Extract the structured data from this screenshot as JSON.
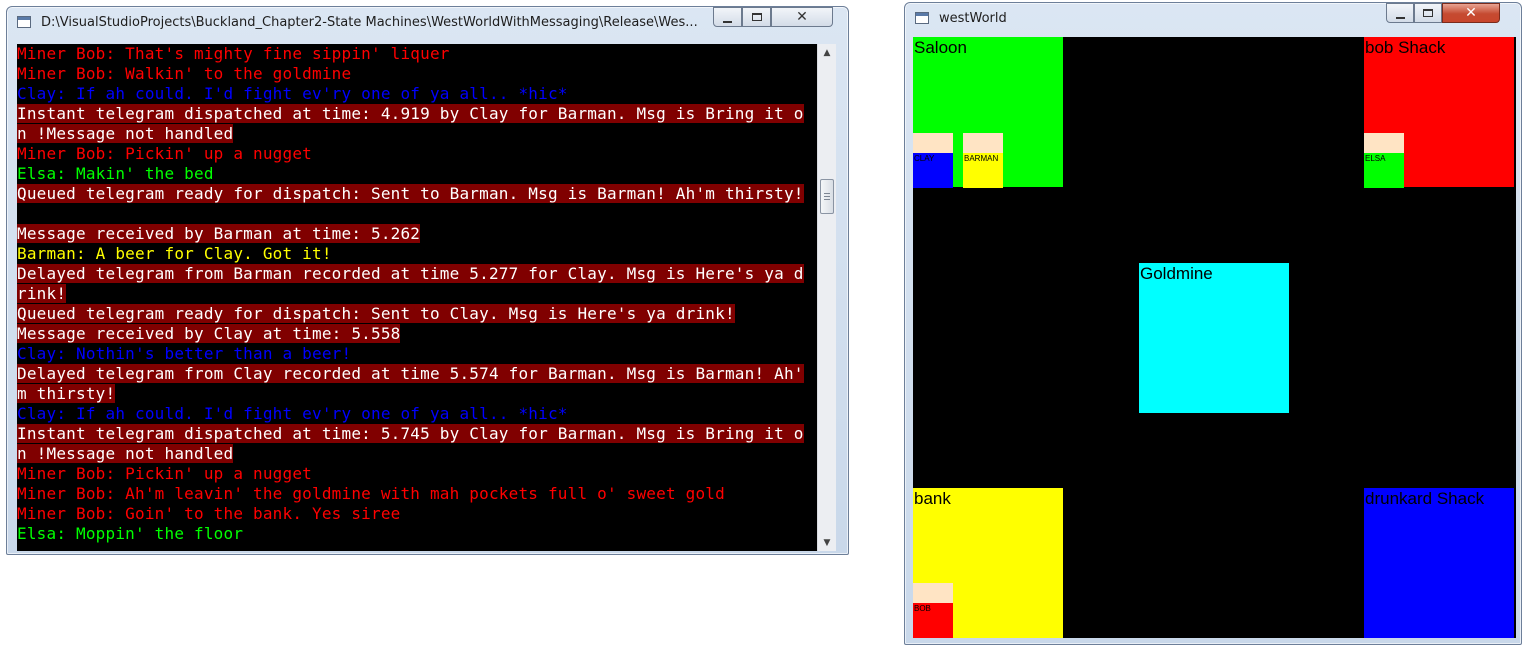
{
  "console_window": {
    "title": "D:\\VisualStudioProjects\\Buckland_Chapter2-State Machines\\WestWorldWithMessaging\\Release\\Wes...",
    "min_label": "",
    "max_label": "",
    "close_label": "✕",
    "scroll_up": "▲",
    "scroll_down": "▼",
    "lines": [
      {
        "text": "Miner Bob: That's mighty fine sippin' liquer",
        "color": "#ff0000",
        "highlight": false
      },
      {
        "text": "Miner Bob: Walkin' to the goldmine",
        "color": "#ff0000",
        "highlight": false
      },
      {
        "text": "Clay: If ah could. I'd fight ev'ry one of ya all.. *hic*",
        "color": "#0000ff",
        "highlight": false
      },
      {
        "text": "Instant telegram dispatched at time: 4.919 by Clay for Barman. Msg is Bring it o",
        "color": "#ffffff",
        "highlight": true
      },
      {
        "text": "n !Message not handled",
        "color": "#ffffff",
        "highlight": true
      },
      {
        "text": "Miner Bob: Pickin' up a nugget",
        "color": "#ff0000",
        "highlight": false
      },
      {
        "text": "Elsa: Makin' the bed",
        "color": "#00ff00",
        "highlight": false
      },
      {
        "text": "Queued telegram ready for dispatch: Sent to Barman. Msg is Barman! Ah'm thirsty!",
        "color": "#ffffff",
        "highlight": true
      },
      {
        "text": "",
        "color": "#ffffff",
        "highlight": false
      },
      {
        "text": "Message received by Barman at time: 5.262",
        "color": "#ffffff",
        "highlight": true
      },
      {
        "text": "Barman: A beer for Clay. Got it!",
        "color": "#ffff00",
        "highlight": false
      },
      {
        "text": "Delayed telegram from Barman recorded at time 5.277 for Clay. Msg is Here's ya d",
        "color": "#ffffff",
        "highlight": true
      },
      {
        "text": "rink!",
        "color": "#ffffff",
        "highlight": true
      },
      {
        "text": "Queued telegram ready for dispatch: Sent to Clay. Msg is Here's ya drink!",
        "color": "#ffffff",
        "highlight": true
      },
      {
        "text": "Message received by Clay at time: 5.558",
        "color": "#ffffff",
        "highlight": true
      },
      {
        "text": "Clay: Nothin's better than a beer!",
        "color": "#0000ff",
        "highlight": false
      },
      {
        "text": "Delayed telegram from Clay recorded at time 5.574 for Barman. Msg is Barman! Ah'",
        "color": "#ffffff",
        "highlight": true
      },
      {
        "text": "m thirsty!",
        "color": "#ffffff",
        "highlight": true
      },
      {
        "text": "Clay: If ah could. I'd fight ev'ry one of ya all.. *hic*",
        "color": "#0000ff",
        "highlight": false
      },
      {
        "text": "Instant telegram dispatched at time: 5.745 by Clay for Barman. Msg is Bring it o",
        "color": "#ffffff",
        "highlight": true
      },
      {
        "text": "n !Message not handled",
        "color": "#ffffff",
        "highlight": true
      },
      {
        "text": "Miner Bob: Pickin' up a nugget",
        "color": "#ff0000",
        "highlight": false
      },
      {
        "text": "Miner Bob: Ah'm leavin' the goldmine with mah pockets full o' sweet gold",
        "color": "#ff0000",
        "highlight": false
      },
      {
        "text": "Miner Bob: Goin' to the bank. Yes siree",
        "color": "#ff0000",
        "highlight": false
      },
      {
        "text": "Elsa: Moppin' the floor",
        "color": "#00ff00",
        "highlight": false
      }
    ]
  },
  "game_window": {
    "title": "westWorld",
    "close_label": "✕",
    "locations": [
      {
        "key": "saloon",
        "label": "Saloon",
        "color": "#00ff00"
      },
      {
        "key": "bob_shack",
        "label": "bob Shack",
        "color": "#ff0000"
      },
      {
        "key": "goldmine",
        "label": "Goldmine",
        "color": "#00ffff"
      },
      {
        "key": "bank",
        "label": "bank",
        "color": "#ffff00"
      },
      {
        "key": "drunkard_shack",
        "label": "drunkard Shack",
        "color": "#0000ff"
      }
    ],
    "agents": [
      {
        "key": "clay",
        "label": "CLAY",
        "color": "#0000ff"
      },
      {
        "key": "barman",
        "label": "BARMAN",
        "color": "#ffff00"
      },
      {
        "key": "elsa",
        "label": "ELSA",
        "color": "#00ff00"
      },
      {
        "key": "bob",
        "label": "BOB",
        "color": "#ff0000"
      }
    ],
    "agent_head_color": "#ffe4c4"
  }
}
